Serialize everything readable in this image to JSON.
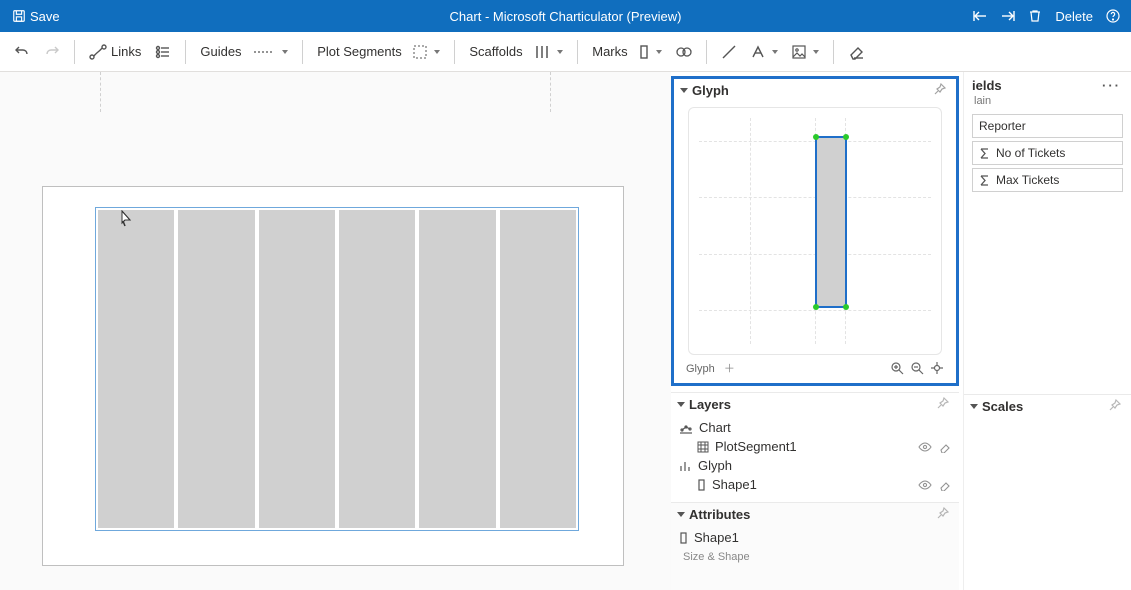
{
  "app": {
    "save_label": "Save",
    "title": "Chart - Microsoft Charticulator (Preview)",
    "delete_label": "Delete"
  },
  "toolbar": {
    "links_label": "Links",
    "guides_label": "Guides",
    "plot_segments_label": "Plot Segments",
    "scaffolds_label": "Scaffolds",
    "marks_label": "Marks"
  },
  "panels": {
    "glyph": {
      "title": "Glyph",
      "footer_label": "Glyph"
    },
    "layers": {
      "title": "Layers",
      "chart_label": "Chart",
      "plotsegment_label": "PlotSegment1",
      "glyph_label": "Glyph",
      "shape_label": "Shape1"
    },
    "attributes": {
      "title": "Attributes",
      "selected_label": "Shape1",
      "section_label": "Size & Shape"
    },
    "fields": {
      "title": "ields",
      "subtitle": "lain",
      "items": [
        "Reporter",
        "No of Tickets",
        "Max Tickets"
      ]
    },
    "scales": {
      "title": "Scales"
    }
  },
  "colors": {
    "accent": "#106ebe",
    "highlight": "#1f6fc9",
    "bar_fill": "#d0d0d0"
  },
  "chart_data": {
    "type": "bar",
    "categories": [
      "",
      "",
      "",
      "",
      "",
      ""
    ],
    "values": [
      1,
      1,
      1,
      1,
      1,
      1
    ],
    "title": "",
    "xlabel": "",
    "ylabel": "",
    "ylim": [
      0,
      1
    ],
    "note": "No axis labels visible; six equal-height grey bars inside a selected plot segment."
  }
}
